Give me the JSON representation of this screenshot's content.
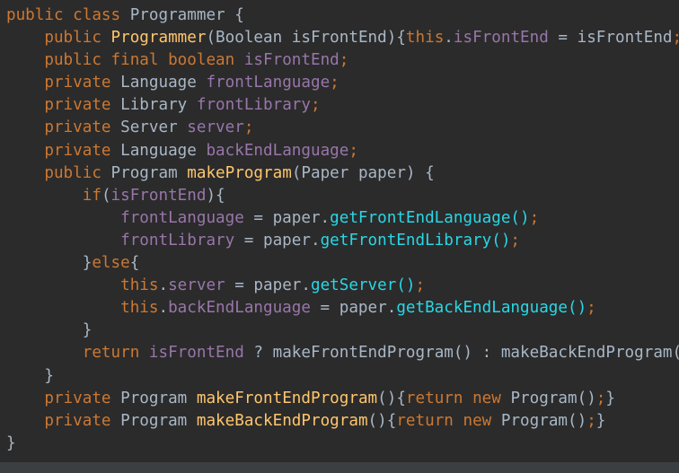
{
  "colors": {
    "background": "#2b2b2b",
    "keyword": "#cc7832",
    "plain": "#a9b7c6",
    "field": "#9876aa",
    "method": "#ffc66d",
    "call": "#28d7e6",
    "semicolon": "#cc7832"
  },
  "code_lines": [
    {
      "indent": 0,
      "tokens": [
        {
          "t": "public class ",
          "c": "keyword"
        },
        {
          "t": "Programmer {",
          "c": "plain"
        }
      ]
    },
    {
      "indent": 1,
      "tokens": [
        {
          "t": "public ",
          "c": "keyword"
        },
        {
          "t": "Programmer",
          "c": "method"
        },
        {
          "t": "(Boolean isFrontEnd){",
          "c": "plain"
        },
        {
          "t": "this",
          "c": "keyword"
        },
        {
          "t": ".",
          "c": "plain"
        },
        {
          "t": "isFrontEnd",
          "c": "field"
        },
        {
          "t": " = isFrontEnd",
          "c": "plain"
        },
        {
          "t": ";",
          "c": "semicolon"
        },
        {
          "t": "}",
          "c": "plain"
        }
      ]
    },
    {
      "indent": 1,
      "tokens": [
        {
          "t": "public final boolean ",
          "c": "keyword"
        },
        {
          "t": "isFrontEnd",
          "c": "field"
        },
        {
          "t": ";",
          "c": "semicolon"
        }
      ]
    },
    {
      "indent": 1,
      "tokens": [
        {
          "t": "private ",
          "c": "keyword"
        },
        {
          "t": "Language ",
          "c": "plain"
        },
        {
          "t": "frontLanguage",
          "c": "field"
        },
        {
          "t": ";",
          "c": "semicolon"
        }
      ]
    },
    {
      "indent": 1,
      "tokens": [
        {
          "t": "private ",
          "c": "keyword"
        },
        {
          "t": "Library ",
          "c": "plain"
        },
        {
          "t": "frontLibrary",
          "c": "field"
        },
        {
          "t": ";",
          "c": "semicolon"
        }
      ]
    },
    {
      "indent": 1,
      "tokens": [
        {
          "t": "private ",
          "c": "keyword"
        },
        {
          "t": "Server ",
          "c": "plain"
        },
        {
          "t": "server",
          "c": "field"
        },
        {
          "t": ";",
          "c": "semicolon"
        }
      ]
    },
    {
      "indent": 1,
      "tokens": [
        {
          "t": "private ",
          "c": "keyword"
        },
        {
          "t": "Language ",
          "c": "plain"
        },
        {
          "t": "backEndLanguage",
          "c": "field"
        },
        {
          "t": ";",
          "c": "semicolon"
        }
      ]
    },
    {
      "indent": 1,
      "tokens": [
        {
          "t": "public ",
          "c": "keyword"
        },
        {
          "t": "Program ",
          "c": "plain"
        },
        {
          "t": "makeProgram",
          "c": "method"
        },
        {
          "t": "(Paper paper) {",
          "c": "plain"
        }
      ]
    },
    {
      "indent": 2,
      "tokens": [
        {
          "t": "if",
          "c": "keyword"
        },
        {
          "t": "(",
          "c": "plain"
        },
        {
          "t": "isFrontEnd",
          "c": "field"
        },
        {
          "t": "){",
          "c": "plain"
        }
      ]
    },
    {
      "indent": 3,
      "tokens": [
        {
          "t": "frontLanguage",
          "c": "field"
        },
        {
          "t": " = paper.",
          "c": "plain"
        },
        {
          "t": "getFrontEndLanguage()",
          "c": "call"
        },
        {
          "t": ";",
          "c": "semicolon"
        }
      ]
    },
    {
      "indent": 3,
      "tokens": [
        {
          "t": "frontLibrary",
          "c": "field"
        },
        {
          "t": " = paper.",
          "c": "plain"
        },
        {
          "t": "getFrontEndLibrary()",
          "c": "call"
        },
        {
          "t": ";",
          "c": "semicolon"
        }
      ]
    },
    {
      "indent": 2,
      "tokens": [
        {
          "t": "}",
          "c": "plain"
        },
        {
          "t": "else",
          "c": "keyword"
        },
        {
          "t": "{",
          "c": "plain"
        }
      ]
    },
    {
      "indent": 3,
      "tokens": [
        {
          "t": "this",
          "c": "keyword"
        },
        {
          "t": ".",
          "c": "plain"
        },
        {
          "t": "server",
          "c": "field"
        },
        {
          "t": " = paper.",
          "c": "plain"
        },
        {
          "t": "getServer()",
          "c": "call"
        },
        {
          "t": ";",
          "c": "semicolon"
        }
      ]
    },
    {
      "indent": 3,
      "tokens": [
        {
          "t": "this",
          "c": "keyword"
        },
        {
          "t": ".",
          "c": "plain"
        },
        {
          "t": "backEndLanguage",
          "c": "field"
        },
        {
          "t": " = paper.",
          "c": "plain"
        },
        {
          "t": "getBackEndLanguage()",
          "c": "call"
        },
        {
          "t": ";",
          "c": "semicolon"
        }
      ]
    },
    {
      "indent": 2,
      "tokens": [
        {
          "t": "}",
          "c": "plain"
        }
      ]
    },
    {
      "indent": 2,
      "tokens": [
        {
          "t": "return ",
          "c": "keyword"
        },
        {
          "t": "isFrontEnd",
          "c": "field"
        },
        {
          "t": " ? makeFrontEndProgram() : makeBackEndProgram()",
          "c": "plain"
        }
      ]
    },
    {
      "indent": 1,
      "tokens": [
        {
          "t": "}",
          "c": "plain"
        }
      ]
    },
    {
      "indent": 1,
      "tokens": [
        {
          "t": "private ",
          "c": "keyword"
        },
        {
          "t": "Program ",
          "c": "plain"
        },
        {
          "t": "makeFrontEndProgram",
          "c": "method"
        },
        {
          "t": "(){",
          "c": "plain"
        },
        {
          "t": "return new ",
          "c": "keyword"
        },
        {
          "t": "Program()",
          "c": "plain"
        },
        {
          "t": ";",
          "c": "semicolon"
        },
        {
          "t": "}",
          "c": "plain"
        }
      ]
    },
    {
      "indent": 1,
      "tokens": [
        {
          "t": "private ",
          "c": "keyword"
        },
        {
          "t": "Program ",
          "c": "plain"
        },
        {
          "t": "makeBackEndProgram",
          "c": "method"
        },
        {
          "t": "(){",
          "c": "plain"
        },
        {
          "t": "return new ",
          "c": "keyword"
        },
        {
          "t": "Program()",
          "c": "plain"
        },
        {
          "t": ";",
          "c": "semicolon"
        },
        {
          "t": "}",
          "c": "plain"
        }
      ]
    },
    {
      "indent": 0,
      "tokens": [
        {
          "t": "}",
          "c": "plain"
        }
      ]
    }
  ]
}
